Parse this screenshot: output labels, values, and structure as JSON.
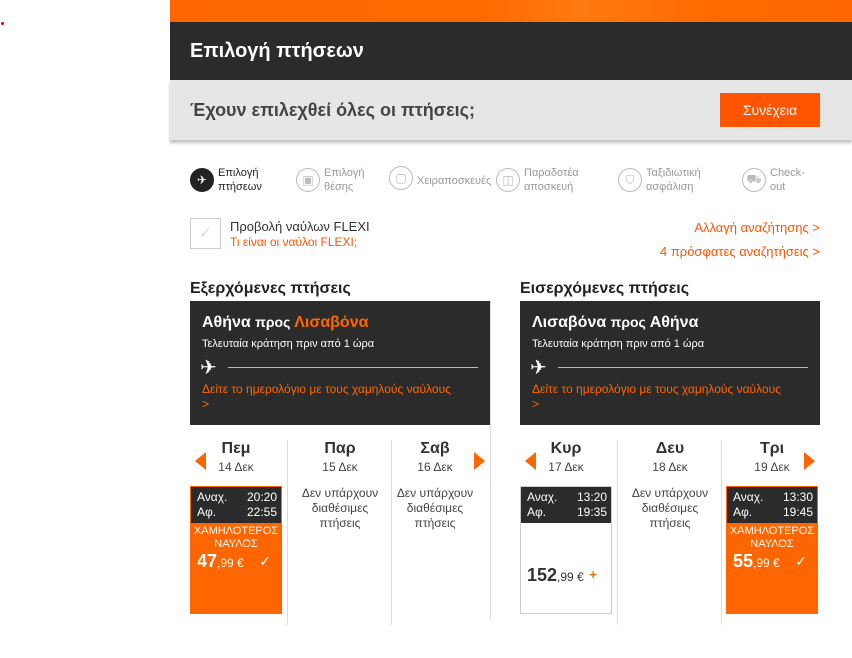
{
  "page": {
    "title": "Επιλογή πτήσεων",
    "question": "Έχουν επιλεχθεί όλες οι πτήσεις;",
    "continue_label": "Συνέχεια"
  },
  "steps": [
    {
      "label1": "Επιλογή",
      "label2": "πτήσεων",
      "icon": "plane-icon",
      "active": true
    },
    {
      "label1": "Επιλογή",
      "label2": "θέσης",
      "icon": "seat-icon",
      "active": false
    },
    {
      "label1": "Χειραποσκευές",
      "label2": "",
      "icon": "bag-icon",
      "active": false
    },
    {
      "label1": "Παραδοτέα",
      "label2": "αποσκευή",
      "icon": "luggage-icon",
      "active": false
    },
    {
      "label1": "Ταξιδιωτική",
      "label2": "ασφάλιση",
      "icon": "shield-icon",
      "active": false
    },
    {
      "label1": "Check-",
      "label2": "out",
      "icon": "cart-icon",
      "active": false
    }
  ],
  "flexi": {
    "label": "Προβολή ναύλων FLEXI",
    "link": "Τι είναι οι ναύλοι FLEXI;"
  },
  "links": {
    "change_search": "Αλλαγή αναζήτησης >",
    "recent_searches": "4 πρόσφατες αναζητήσεις >"
  },
  "outbound": {
    "heading": "Εξερχόμενες πτήσεις",
    "origin": "Αθήνα",
    "to": "προς",
    "destination": "Λισαβόνα",
    "last_booking": "Τελευταία κράτηση πριν από 1 ώρα",
    "calendar_link": "Δείτε το ημερολόγιο με τους χαμηλούς ναύλους",
    "calendar_arrow": ">",
    "days": [
      {
        "name": "Πεμ",
        "date": "14 Δεκ",
        "dep_label": "Αναχ.",
        "dep": "20:20",
        "arr_label": "Αφ.",
        "arr": "22:55",
        "low_label": "ΧΑΜΗΛΟΤΕΡΟΣ ΝΑΥΛΟΣ",
        "price_int": "47",
        "price_dec": ",99 €"
      },
      {
        "name": "Παρ",
        "date": "15 Δεκ",
        "na": "Δεν υπάρχουν διαθέσιμες πτήσεις"
      },
      {
        "name": "Σαβ",
        "date": "16 Δεκ",
        "na": "Δεν υπάρχουν διαθέσιμες πτήσεις"
      }
    ]
  },
  "inbound": {
    "heading": "Εισερχόμενες πτήσεις",
    "origin": "Λισαβόνα",
    "to": "προς",
    "destination": "Αθήνα",
    "last_booking": "Τελευταία κράτηση πριν από 1 ώρα",
    "calendar_link": "Δείτε το ημερολόγιο με τους χαμηλούς ναύλους",
    "calendar_arrow": ">",
    "days": [
      {
        "name": "Κυρ",
        "date": "17 Δεκ",
        "dep_label": "Αναχ.",
        "dep": "13:20",
        "arr_label": "Αφ.",
        "arr": "19:35",
        "price_int": "152",
        "price_dec": ",99 €",
        "plus": "+"
      },
      {
        "name": "Δευ",
        "date": "18 Δεκ",
        "na": "Δεν υπάρχουν διαθέσιμες πτήσεις"
      },
      {
        "name": "Τρι",
        "date": "19 Δεκ",
        "dep_label": "Αναχ.",
        "dep": "13:30",
        "arr_label": "Αφ.",
        "arr": "19:45",
        "low_label": "ΧΑΜΗΛΟΤΕΡΟΣ ΝΑΥΛΟΣ",
        "price_int": "55",
        "price_dec": ",99 €"
      }
    ]
  },
  "colors": {
    "accent": "#ff6600",
    "dark": "#2b2b2b"
  }
}
